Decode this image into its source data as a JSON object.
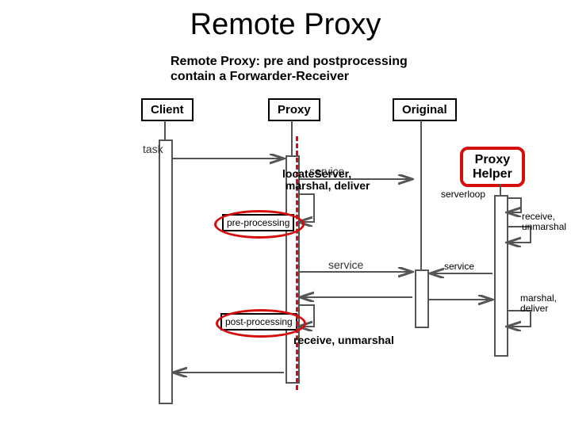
{
  "title": "Remote Proxy",
  "subtitle_l1": "Remote Proxy: pre and postprocessing",
  "subtitle_l2": "contain  a Forwarder-Receiver",
  "boxes": {
    "client": "Client",
    "proxy": "Proxy",
    "original": "Original",
    "proxy_helper_l1": "Proxy",
    "proxy_helper_l2": "Helper"
  },
  "msgs": {
    "task": "task",
    "service1": "service",
    "pre": "pre-processing",
    "post": "post-processing",
    "service2": "service",
    "serverloop": "serverloop",
    "service3": "service"
  },
  "annots": {
    "locate_l1": "locateServer,",
    "locate_l2": "marshal, deliver",
    "recv_unm": "receive, unmarshal",
    "recv_l1": "receive,",
    "recv_l2": "unmarshal",
    "md_l1": "marshal,",
    "md_l2": "deliver"
  }
}
